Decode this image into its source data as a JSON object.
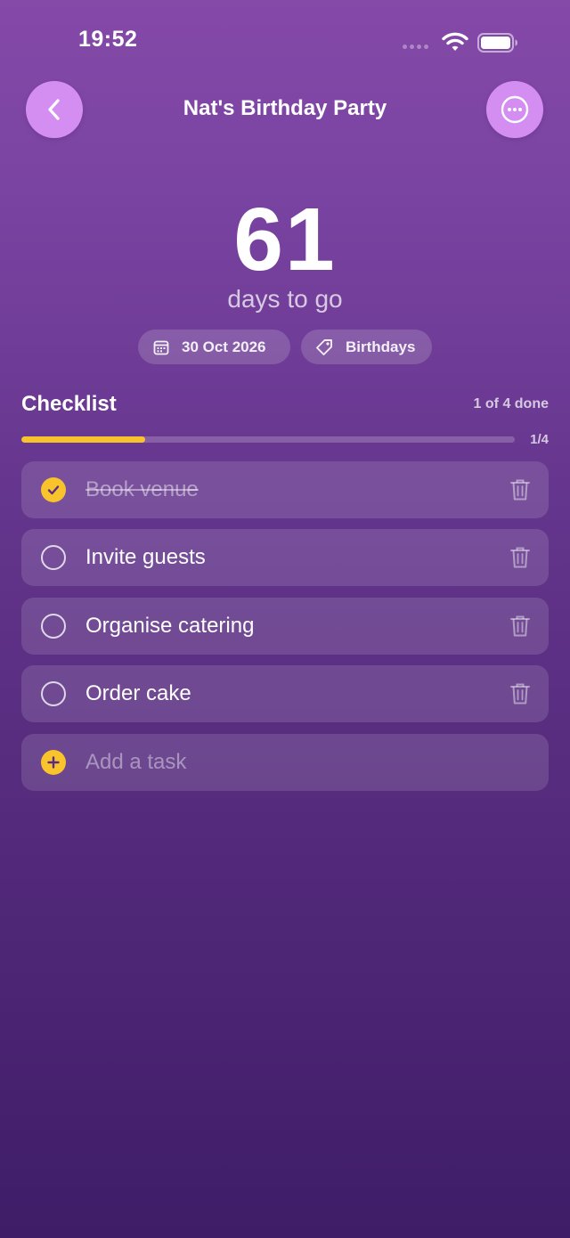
{
  "status_bar": {
    "time": "19:52"
  },
  "header": {
    "title": "Nat's Birthday Party",
    "back_icon": "chevron-left-icon",
    "more_icon": "ellipsis-circle-icon"
  },
  "countdown": {
    "number": "61",
    "label": "days to go"
  },
  "chips": {
    "date": "30 Oct 2026",
    "date_icon": "calendar-icon",
    "category": "Birthdays",
    "category_icon": "tag-icon"
  },
  "checklist": {
    "title": "Checklist",
    "done_text": "1 of 4 done",
    "progress_fraction": "1/4",
    "progress_value": 0.25,
    "tasks": [
      {
        "label": "Book venue",
        "done": true
      },
      {
        "label": "Invite guests",
        "done": false
      },
      {
        "label": "Organise catering",
        "done": false
      },
      {
        "label": "Order cake",
        "done": false
      }
    ],
    "add_placeholder": "Add a task"
  },
  "colors": {
    "accent": "#F8C32B",
    "button": "#D48EF2",
    "background_top": "#8549A8",
    "background_bottom": "#3F1D67"
  }
}
